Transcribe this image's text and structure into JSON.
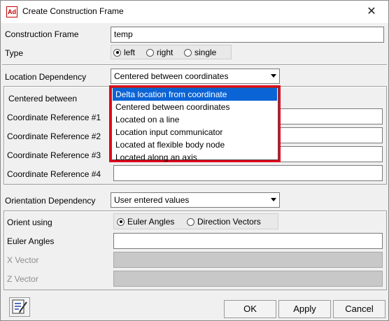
{
  "window": {
    "title": "Create Construction Frame",
    "app_icon_text": "Ad",
    "close_glyph": "✕"
  },
  "construction_frame": {
    "label": "Construction Frame",
    "value": "temp"
  },
  "type": {
    "label": "Type",
    "options": [
      {
        "label": "left",
        "selected": true
      },
      {
        "label": "right",
        "selected": false
      },
      {
        "label": "single",
        "selected": false
      }
    ]
  },
  "location": {
    "label": "Location Dependency",
    "selected": "Centered between coordinates",
    "dropdown_options": [
      "Delta location from coordinate",
      "Centered between coordinates",
      "Located on a line",
      "Location input communicator",
      "Located at flexible body node",
      "Located along an axis"
    ],
    "highlighted_option": "Delta location from coordinate",
    "highlight_border_color": "#e0001b"
  },
  "location_section": {
    "centered_between_label": "Centered between",
    "refs": [
      {
        "label": "Coordinate Reference #1",
        "value": ""
      },
      {
        "label": "Coordinate Reference #2",
        "value": ""
      },
      {
        "label": "Coordinate Reference #3",
        "value": ""
      },
      {
        "label": "Coordinate Reference #4",
        "value": ""
      }
    ]
  },
  "orientation": {
    "label": "Orientation Dependency",
    "selected": "User entered values"
  },
  "orientation_section": {
    "orient_using_label": "Orient using",
    "options": [
      {
        "label": "Euler Angles",
        "selected": true
      },
      {
        "label": "Direction Vectors",
        "selected": false
      }
    ],
    "euler_label": "Euler Angles",
    "euler_value": "",
    "x_vector_label": "X Vector",
    "z_vector_label": "Z Vector"
  },
  "buttons": {
    "ok": "OK",
    "apply": "Apply",
    "cancel": "Cancel"
  },
  "colors": {
    "selection_blue": "#0a64d6",
    "dialog_bg": "#f0f0f0"
  }
}
